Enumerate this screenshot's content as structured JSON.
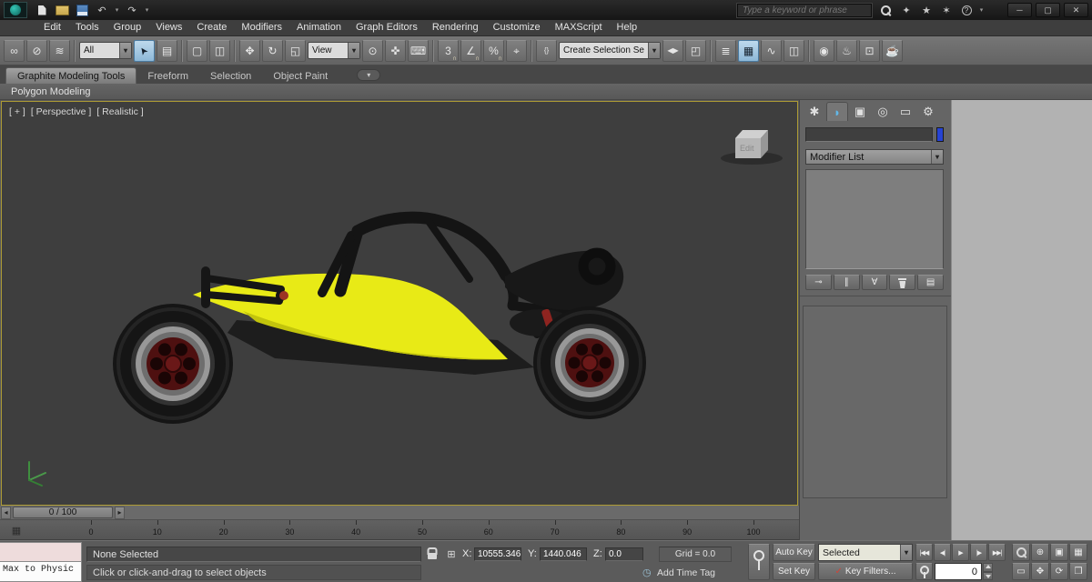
{
  "titlebar": {
    "search_placeholder": "Type a keyword or phrase",
    "quick_icons": [
      {
        "name": "new-scene-icon",
        "cls": "i-file"
      },
      {
        "name": "open-file-icon",
        "cls": "i-folder"
      },
      {
        "name": "save-file-icon",
        "cls": "i-save"
      },
      {
        "name": "undo-icon",
        "glyph": "↶"
      },
      {
        "name": "undo-dropdown-caret-icon",
        "glyph": "▾",
        "cls": "caret-btn"
      },
      {
        "name": "redo-icon",
        "glyph": "↷"
      },
      {
        "name": "redo-dropdown-caret-icon",
        "glyph": "▾",
        "cls": "caret-btn"
      }
    ],
    "info_icons": [
      {
        "name": "search-icon",
        "cls": "i-mag"
      },
      {
        "name": "sign-in-icon",
        "glyph": "✦"
      },
      {
        "name": "favorites-star-icon",
        "glyph": "★"
      },
      {
        "name": "communication-center-icon",
        "glyph": "✶"
      },
      {
        "name": "help-icon",
        "glyph": "?",
        "cls": "i-help"
      },
      {
        "name": "help-dropdown-caret-icon",
        "glyph": "▾",
        "cls": "caret-btn"
      }
    ],
    "window_buttons": [
      {
        "name": "minimize-button",
        "glyph": "─"
      },
      {
        "name": "maximize-button",
        "glyph": "▢"
      },
      {
        "name": "close-button",
        "glyph": "✕"
      }
    ]
  },
  "menubar": {
    "items": [
      {
        "label": "Edit",
        "name": "menu-edit"
      },
      {
        "label": "Tools",
        "name": "menu-tools"
      },
      {
        "label": "Group",
        "name": "menu-group"
      },
      {
        "label": "Views",
        "name": "menu-views"
      },
      {
        "label": "Create",
        "name": "menu-create"
      },
      {
        "label": "Modifiers",
        "name": "menu-modifiers"
      },
      {
        "label": "Animation",
        "name": "menu-animation"
      },
      {
        "label": "Graph Editors",
        "name": "menu-graph-editors"
      },
      {
        "label": "Rendering",
        "name": "menu-rendering"
      },
      {
        "label": "Customize",
        "name": "menu-customize"
      },
      {
        "label": "MAXScript",
        "name": "menu-maxscript"
      },
      {
        "label": "Help",
        "name": "menu-help"
      }
    ]
  },
  "toolbar": {
    "items": [
      {
        "name": "select-and-link-icon",
        "glyph": "∞"
      },
      {
        "name": "unlink-selection-icon",
        "glyph": "⊘"
      },
      {
        "name": "bind-to-space-warp-icon",
        "glyph": "≋"
      },
      {
        "cls": "sep"
      },
      {
        "name": "selection-filter-dropdown",
        "cls": "dd dd-sm",
        "label": "All"
      },
      {
        "name": "select-object-icon",
        "glyph": "➤",
        "cls": "cursor active"
      },
      {
        "name": "select-by-name-icon",
        "glyph": "▤"
      },
      {
        "cls": "sep"
      },
      {
        "name": "rectangular-selection-region-icon",
        "glyph": "▢"
      },
      {
        "name": "window-crossing-toggle-icon",
        "glyph": "◫"
      },
      {
        "cls": "sep"
      },
      {
        "name": "select-and-move-icon",
        "glyph": "✥"
      },
      {
        "name": "select-and-rotate-icon",
        "glyph": "↻"
      },
      {
        "name": "select-and-uniform-scale-icon",
        "glyph": "◱"
      },
      {
        "name": "reference-coordinate-system-dropdown",
        "cls": "dd dd-sm",
        "label": "View"
      },
      {
        "name": "use-pivot-point-center-icon",
        "glyph": "⊙"
      },
      {
        "name": "select-and-manipulate-icon",
        "glyph": "✜"
      },
      {
        "name": "keyboard-shortcut-override-icon",
        "glyph": "⌨"
      },
      {
        "cls": "sep"
      },
      {
        "name": "snaps-toggle-icon",
        "glyph": "3",
        "cls": "snap"
      },
      {
        "name": "angle-snap-toggle-icon",
        "glyph": "∠",
        "cls": "snap"
      },
      {
        "name": "percent-snap-toggle-icon",
        "glyph": "%",
        "cls": "snap"
      },
      {
        "name": "spinner-snap-toggle-icon",
        "glyph": "⌖"
      },
      {
        "cls": "sep"
      },
      {
        "name": "edit-named-selection-sets-icon",
        "glyph": "{}",
        "cls": "sm"
      },
      {
        "name": "named-selection-sets-dropdown",
        "cls": "dd dd-lg",
        "label": "Create Selection Se"
      },
      {
        "name": "mirror-icon",
        "glyph": "◀▶",
        "cls": "sm"
      },
      {
        "name": "align-icon",
        "glyph": "◰"
      },
      {
        "cls": "sep"
      },
      {
        "name": "layer-manager-icon",
        "glyph": "≣"
      },
      {
        "name": "graphite-ribbon-toggle-icon",
        "glyph": "▦",
        "cls": "active"
      },
      {
        "name": "curve-editor-icon",
        "glyph": "∿"
      },
      {
        "name": "schematic-view-icon",
        "glyph": "◫"
      },
      {
        "cls": "sep"
      },
      {
        "name": "material-editor-icon",
        "glyph": "◉"
      },
      {
        "name": "render-setup-icon",
        "glyph": "♨"
      },
      {
        "name": "rendered-frame-window-icon",
        "glyph": "⊡"
      },
      {
        "name": "render-production-icon",
        "glyph": "☕"
      }
    ]
  },
  "ribbon": {
    "tabs": [
      {
        "label": "Graphite Modeling Tools",
        "name": "tab-graphite-modeling-tools",
        "cls": "active"
      },
      {
        "label": "Freeform",
        "name": "tab-freeform"
      },
      {
        "label": "Selection",
        "name": "tab-selection"
      },
      {
        "label": "Object Paint",
        "name": "tab-object-paint"
      }
    ],
    "panel_label": "Polygon Modeling"
  },
  "viewport": {
    "label_general": "[ + ]",
    "label_pov": "[ Perspective ]",
    "label_shading": "[ Realistic ]",
    "cube_label": "Edit"
  },
  "command_panel": {
    "tabs": [
      {
        "name": "tab-create-icon",
        "glyph": "✱"
      },
      {
        "name": "tab-modify-icon",
        "glyph": "◗",
        "cls": "active c-teal"
      },
      {
        "name": "tab-hierarchy-icon",
        "glyph": "▣"
      },
      {
        "name": "tab-motion-icon",
        "glyph": "◎"
      },
      {
        "name": "tab-display-icon",
        "glyph": "▭"
      },
      {
        "name": "tab-utilities-icon",
        "glyph": "⚙"
      }
    ],
    "name_field_value": "",
    "modifier_list_label": "Modifier List",
    "stack_buttons": [
      {
        "name": "pin-stack-icon",
        "glyph": "⊸"
      },
      {
        "name": "show-end-result-icon",
        "glyph": "∥"
      },
      {
        "name": "make-unique-icon",
        "glyph": "∀"
      },
      {
        "name": "remove-modifier-icon",
        "cls": "i-trash"
      },
      {
        "name": "configure-modifier-sets-icon",
        "glyph": "▤"
      }
    ]
  },
  "trackbar": {
    "left_arrow": "◂",
    "slider_label": "0 / 100",
    "right_arrow": "▸"
  },
  "timeline": {
    "ticks": [
      "0",
      "10",
      "20",
      "30",
      "40",
      "50",
      "60",
      "70",
      "80",
      "90",
      "100"
    ]
  },
  "status": {
    "listener_text": "Max to Physic",
    "selection_status": "None Selected",
    "prompt": "Click or click-and-drag to select objects",
    "abs_offset_glyph": "⊞",
    "open_mini_curve_glyph": "▦",
    "x_label": "X:",
    "x_value": "10555.346",
    "y_label": "Y:",
    "y_value": "1440.046",
    "z_label": "Z:",
    "z_value": "0.0",
    "grid_label": "Grid = 0.0",
    "time_tag_glyph": "◷",
    "time_tag_label": "Add Time Tag"
  },
  "anim": {
    "auto_key_label": "Auto Key",
    "set_key_label": "Set Key",
    "selection_dropdown_value": "Selected",
    "key_filters_icon_glyph": "✓",
    "key_filters_label": "Key Filters...",
    "frame_value": "0",
    "transport": [
      {
        "name": "go-to-start-button",
        "glyph": "|◀◀"
      },
      {
        "name": "previous-frame-button",
        "glyph": "◀|"
      },
      {
        "name": "play-button",
        "glyph": "▶"
      },
      {
        "name": "next-frame-button",
        "glyph": "|▶"
      },
      {
        "name": "go-to-end-button",
        "glyph": "▶▶|"
      }
    ],
    "nav_row1": [
      {
        "name": "zoom-icon",
        "cls": "i-mag"
      },
      {
        "name": "zoom-all-icon",
        "glyph": "⊕"
      },
      {
        "name": "zoom-extents-icon",
        "glyph": "▣"
      },
      {
        "name": "zoom-extents-all-icon",
        "glyph": "▦"
      }
    ],
    "nav_row2": [
      {
        "name": "zoom-region-icon",
        "glyph": "▭"
      },
      {
        "name": "pan-icon",
        "glyph": "✥"
      },
      {
        "name": "orbit-icon",
        "glyph": "⟳"
      },
      {
        "name": "maximize-viewport-toggle-icon",
        "glyph": "❒"
      }
    ]
  },
  "colors": {
    "accent_yellow": "#e8ea16",
    "viewport_border": "#ad9b34",
    "object_swatch_blue": "#2643d4",
    "macro_recorder_pink": "#eedcdc"
  }
}
